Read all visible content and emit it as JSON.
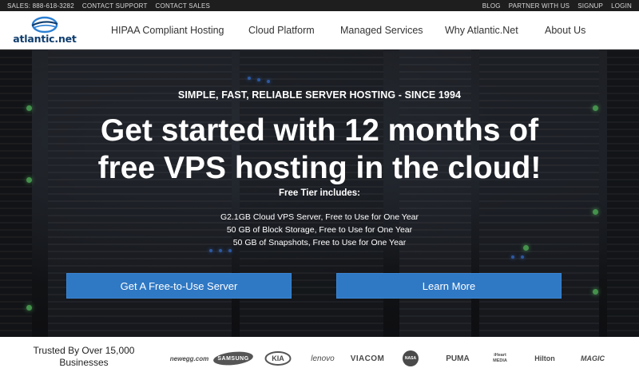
{
  "topbar": {
    "left": [
      "SALES: 888-618-3282",
      "CONTACT SUPPORT",
      "CONTACT SALES"
    ],
    "right": [
      "BLOG",
      "PARTNER WITH US",
      "SIGNUP",
      "LOGIN"
    ]
  },
  "logo": {
    "text": "atlantic.net"
  },
  "nav": {
    "items": [
      "HIPAA Compliant Hosting",
      "Cloud Platform",
      "Managed Services",
      "Why Atlantic.Net",
      "About Us"
    ]
  },
  "hero": {
    "subtitle": "SIMPLE, FAST, RELIABLE SERVER HOSTING - SINCE 1994",
    "title_line1": "Get started with 12 months of",
    "title_line2": "free VPS hosting in the cloud!",
    "tier_heading": "Free Tier includes:",
    "features": [
      "G2.1GB Cloud VPS Server, Free to Use for One Year",
      "50 GB of Block Storage, Free to Use for One Year",
      "50 GB of Snapshots, Free to Use for One Year"
    ],
    "primary_button": "Get A Free-to-Use Server",
    "secondary_button": "Learn More"
  },
  "trusted": {
    "line1": "Trusted By Over 15,000",
    "line2": "Businesses",
    "brands": [
      "newegg.com",
      "SAMSUNG",
      "KIA",
      "lenovo",
      "VIACOM",
      "NASA",
      "PUMA",
      "iHeart MEDIA",
      "Hilton",
      "MAGIC"
    ]
  },
  "colors": {
    "topbar_bg": "#1e1e1e",
    "button_blue": "#2f78c4",
    "logo_blue": "#0f3d6e"
  }
}
